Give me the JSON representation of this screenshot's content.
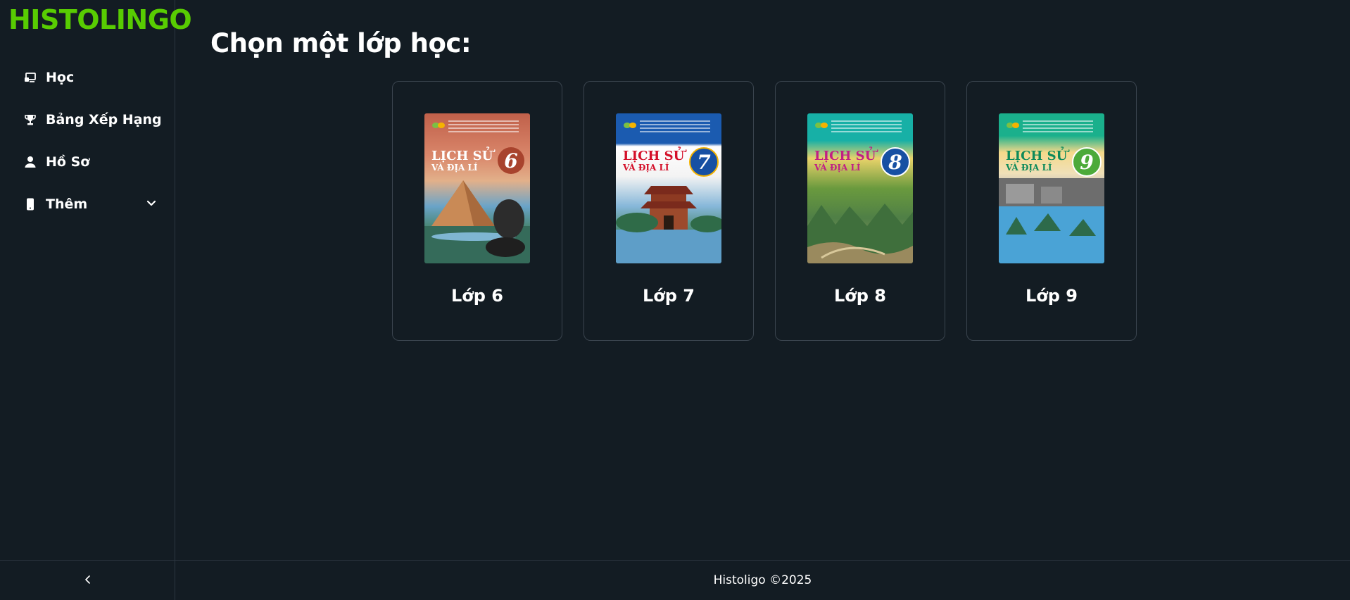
{
  "app": {
    "logo": "HISTOLINGO"
  },
  "sidebar": {
    "items": [
      {
        "label": "Học",
        "icon": "learn-icon"
      },
      {
        "label": "Bảng Xếp Hạng",
        "icon": "trophy-icon"
      },
      {
        "label": "Hồ Sơ",
        "icon": "user-icon"
      },
      {
        "label": "Thêm",
        "icon": "mobile-icon",
        "has_dropdown": true
      }
    ],
    "collapse_icon": "chevron-left-icon"
  },
  "main": {
    "title": "Chọn một lớp học:",
    "grades": [
      {
        "label": "Lớp 6",
        "cover_title_1": "LỊCH SỬ",
        "cover_title_2": "VÀ ĐỊA LÍ",
        "cover_number": "6",
        "cover_color": "#c25a3e"
      },
      {
        "label": "Lớp 7",
        "cover_title_1": "LỊCH SỬ",
        "cover_title_2": "VÀ ĐỊA LÍ",
        "cover_number": "7",
        "cover_color": "#1557a8"
      },
      {
        "label": "Lớp 8",
        "cover_title_1": "LỊCH SỬ",
        "cover_title_2": "VÀ ĐỊA LÍ",
        "cover_number": "8",
        "cover_color": "#16a9a0"
      },
      {
        "label": "Lớp 9",
        "cover_title_1": "LỊCH SỬ",
        "cover_title_2": "VÀ ĐỊA LÍ",
        "cover_number": "9",
        "cover_color": "#19b08a"
      }
    ]
  },
  "footer": {
    "text": "Histoligo ©2025"
  },
  "colors": {
    "background": "#131c23",
    "brand": "#58cc02",
    "border": "#3a444e"
  }
}
